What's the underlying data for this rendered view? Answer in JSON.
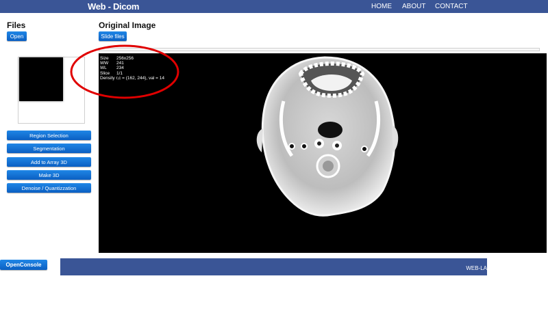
{
  "header": {
    "brand": "Web - Dicom",
    "nav": [
      "HOME",
      "ABOUT",
      "CONTACT"
    ]
  },
  "sidebar": {
    "title": "Files",
    "open_label": "Open",
    "menu": [
      "Region Selection",
      "Segmentation",
      "Add to Array 3D",
      "Make 3D",
      "Denoise / Quantizzation"
    ]
  },
  "main": {
    "title": "Original Image",
    "slide_label": "Slide files",
    "info": [
      {
        "key": "Size",
        "value": "256x256"
      },
      {
        "key": "WW",
        "value": "241"
      },
      {
        "key": "WL",
        "value": "234"
      },
      {
        "key": "Slice",
        "value": "1/1"
      }
    ],
    "density": "Density r,c = (162, 244), val = 14"
  },
  "console_label": "OpenConsole",
  "footer": {
    "text": "WEB-LA"
  },
  "colors": {
    "header_bg": "#3a5596",
    "button": "#0b6fd8",
    "highlight": "#e00000"
  }
}
